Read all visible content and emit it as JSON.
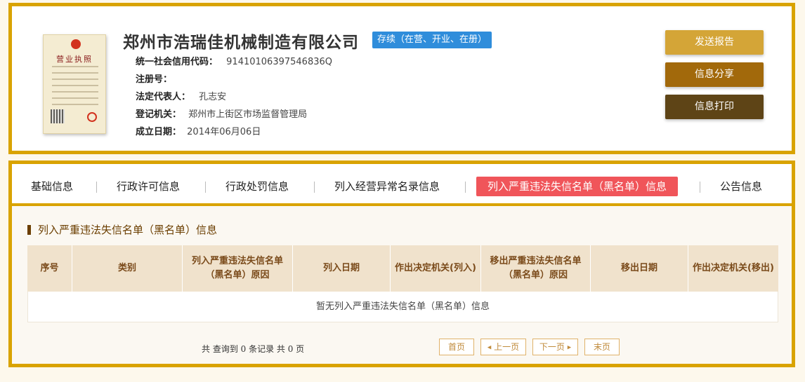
{
  "company": {
    "name": "郑州市浩瑞佳机械制造有限公司",
    "status": "存续（在营、开业、在册）",
    "license_title": "营业执照",
    "fields": [
      {
        "label": "统一社会信用代码：",
        "value": "91410106397546836Q"
      },
      {
        "label": "注册号：",
        "value": ""
      },
      {
        "label": "法定代表人：",
        "value": "孔志安"
      },
      {
        "label": "登记机关：",
        "value": "郑州市上街区市场监督管理局"
      },
      {
        "label": "成立日期：",
        "value": "2014年06月06日"
      }
    ]
  },
  "actions": {
    "send_report": "发送报告",
    "share": "信息分享",
    "print": "信息打印"
  },
  "tabs": [
    {
      "label": "基础信息"
    },
    {
      "label": "行政许可信息"
    },
    {
      "label": "行政处罚信息"
    },
    {
      "label": "列入经营异常名录信息"
    },
    {
      "label": "列入严重违法失信名单（黑名单）信息",
      "active": true
    },
    {
      "label": "公告信息"
    }
  ],
  "section": {
    "title": "列入严重违法失信名单（黑名单）信息"
  },
  "table": {
    "columns": [
      "序号",
      "类别",
      "列入严重违法失信名单（黑名单）原因",
      "列入日期",
      "作出决定机关(列入)",
      "移出严重违法失信名单（黑名单）原因",
      "移出日期",
      "作出决定机关(移出)"
    ],
    "empty_text": "暂无列入严重违法失信名单（黑名单）信息"
  },
  "pagination": {
    "summary": "共 查询到 0 条记录 共 0 页",
    "first": "首页",
    "prev": "上一页",
    "next": "下一页",
    "last": "末页"
  },
  "colors": {
    "accent_border": "#d9a300",
    "status_badge": "#2f8ddb",
    "active_tab": "#f0555a",
    "btn_report": "#d4a537",
    "btn_share": "#a2690b",
    "btn_print": "#5e4416"
  }
}
